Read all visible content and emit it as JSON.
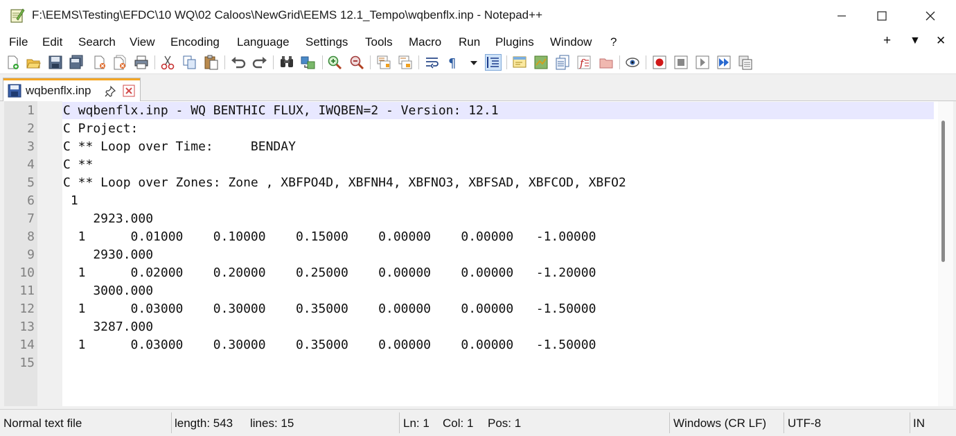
{
  "window": {
    "title": "F:\\EEMS\\Testing\\EFDC\\10 WQ\\02 Caloos\\NewGrid\\EEMS 12.1_Tempo\\wqbenflx.inp - Notepad++",
    "minimize": "—",
    "maximize": "☐",
    "close": "✕"
  },
  "menu": {
    "items": [
      "File",
      "Edit",
      "Search",
      "View",
      "Encoding",
      "Language",
      "Settings",
      "Tools",
      "Macro",
      "Run",
      "Plugins",
      "Window",
      "?"
    ],
    "right": {
      "add": "+",
      "dropdown": "▼",
      "close": "✕"
    }
  },
  "toolbar": {
    "icons": [
      "new-file-icon",
      "open-file-icon",
      "save-icon",
      "save-all-icon",
      "close-icon",
      "close-all-icon",
      "print-icon",
      "cut-icon",
      "copy-icon",
      "paste-icon",
      "undo-icon",
      "redo-icon",
      "find-icon",
      "replace-icon",
      "zoom-in-icon",
      "zoom-out-icon",
      "sync-vertical-icon",
      "sync-horizontal-icon",
      "word-wrap-icon",
      "show-all-characters-icon",
      "dropdown-icon",
      "indent-guide-icon",
      "user-defined-language-icon",
      "document-map-icon",
      "document-list-icon",
      "function-list-icon",
      "folder-as-workspace-icon",
      "monitoring-icon",
      "record-macro-icon",
      "stop-macro-icon",
      "play-macro-icon",
      "run-macro-multiple-icon",
      "save-macro-icon"
    ]
  },
  "tab": {
    "label": "wqbenflx.inp"
  },
  "editor": {
    "lines": [
      {
        "n": "1",
        "text": "C wqbenflx.inp - WQ BENTHIC FLUX, IWQBEN=2 - Version: 12.1"
      },
      {
        "n": "2",
        "text": "C Project:"
      },
      {
        "n": "3",
        "text": "C ** Loop over Time:     BENDAY"
      },
      {
        "n": "4",
        "text": "C **"
      },
      {
        "n": "5",
        "text": "C ** Loop over Zones: Zone , XBFPO4D, XBFNH4, XBFNO3, XBFSAD, XBFCOD, XBFO2"
      },
      {
        "n": "6",
        "text": " 1"
      },
      {
        "n": "7",
        "text": "    2923.000"
      },
      {
        "n": "8",
        "text": "  1      0.01000    0.10000    0.15000    0.00000    0.00000   -1.00000"
      },
      {
        "n": "9",
        "text": "    2930.000"
      },
      {
        "n": "10",
        "text": "  1      0.02000    0.20000    0.25000    0.00000    0.00000   -1.20000"
      },
      {
        "n": "11",
        "text": "    3000.000"
      },
      {
        "n": "12",
        "text": "  1      0.03000    0.30000    0.35000    0.00000    0.00000   -1.50000"
      },
      {
        "n": "13",
        "text": "    3287.000"
      },
      {
        "n": "14",
        "text": "  1      0.03000    0.30000    0.35000    0.00000    0.00000   -1.50000"
      },
      {
        "n": "15",
        "text": ""
      }
    ]
  },
  "status": {
    "file_type": "Normal text file",
    "length": "length: 543",
    "lines": "lines: 15",
    "ln": "Ln: 1",
    "col": "Col: 1",
    "pos": "Pos: 1",
    "eol": "Windows (CR LF)",
    "encoding": "UTF-8",
    "mode": "IN"
  },
  "colors": {
    "accent": "#f5a623",
    "current_line": "#e8e8ff",
    "line_number": "#808080"
  }
}
